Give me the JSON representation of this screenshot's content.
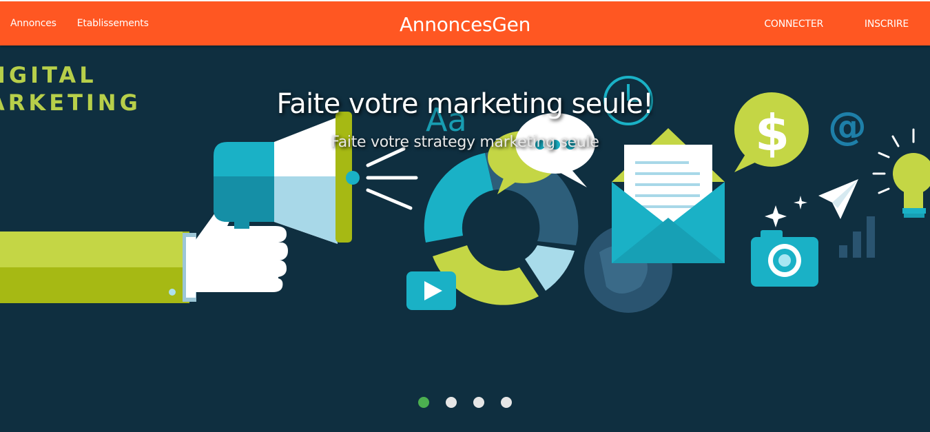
{
  "navbar": {
    "brand": "AnnoncesGen",
    "left_links": [
      "Annonces",
      "Etablissements"
    ],
    "right_links": [
      "CONNECTER",
      "INSCRIRE"
    ],
    "background": "#ff5722"
  },
  "slider": {
    "background": "#0f2f40",
    "title": "Faite votre marketing seule!",
    "subtitle": "Faite votre strategy marketing seule",
    "artwork_text": [
      "IGITAL",
      "ARKETING"
    ],
    "slide_count": 4,
    "active_slide": 1,
    "indicator_active_color": "#4caf50",
    "indicator_color": "#e6e6e6"
  },
  "icons": [
    "megaphone-icon",
    "hand-icon",
    "donut-chart-icon",
    "speech-bubbles-icon",
    "play-icon",
    "clock-icon",
    "envelope-icon",
    "globe-icon",
    "dollar-bubble-icon",
    "at-sign-icon",
    "camera-icon",
    "paper-plane-icon",
    "bar-chart-icon",
    "lightbulb-icon",
    "sparkle-icon"
  ]
}
